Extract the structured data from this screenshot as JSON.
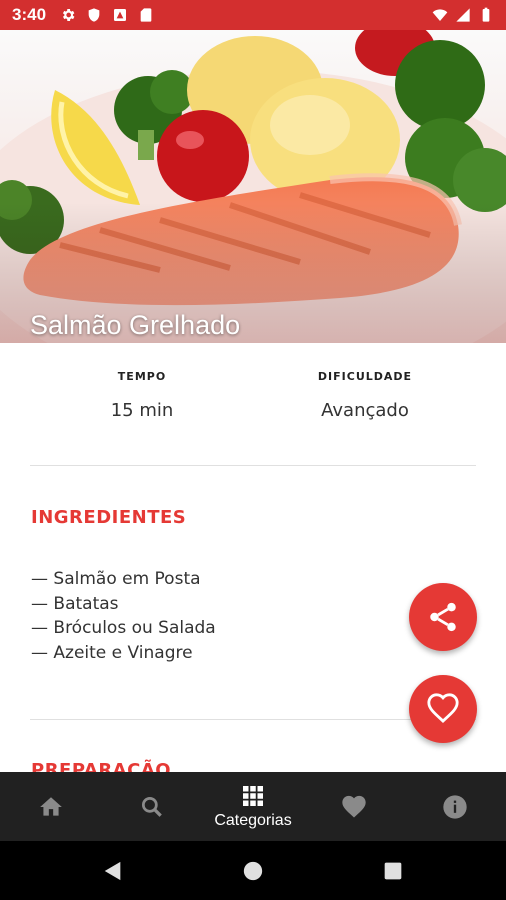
{
  "status_bar": {
    "time": "3:40",
    "background": "#d32f2f",
    "left_icons": [
      "settings-icon",
      "shield-icon",
      "app-icon",
      "sd-card-icon"
    ],
    "right_icons": [
      "wifi-icon",
      "signal-icon",
      "battery-icon"
    ]
  },
  "recipe": {
    "title": "Salmão Grelhado",
    "info": {
      "time_label": "TEMPO",
      "time_value": "15 min",
      "difficulty_label": "DIFICULDADE",
      "difficulty_value": "Avançado"
    },
    "ingredients_title": "INGREDIENTES",
    "ingredients": [
      "— Salmão em Posta",
      "— Batatas",
      "— Bróculos ou Salada",
      "— Azeite e Vinagre"
    ],
    "preparation_title": "PREPARAÇÃO"
  },
  "fabs": {
    "share_icon": "share-icon",
    "favorite_icon": "heart-outline-icon",
    "color": "#e53935"
  },
  "bottom_nav": {
    "items": [
      {
        "icon": "home-icon",
        "label": ""
      },
      {
        "icon": "search-icon",
        "label": ""
      },
      {
        "icon": "grid-icon",
        "label": "Categorias",
        "active": true
      },
      {
        "icon": "heart-icon",
        "label": ""
      },
      {
        "icon": "info-icon",
        "label": ""
      }
    ]
  },
  "system_nav": [
    "back-icon",
    "home-circle-icon",
    "recents-icon"
  ],
  "colors": {
    "accent": "#e53935",
    "nav_background": "#212121"
  }
}
